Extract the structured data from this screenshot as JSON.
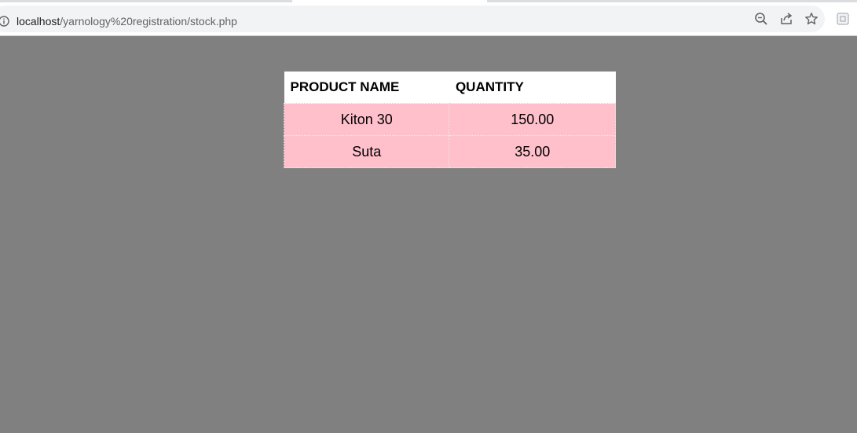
{
  "browser": {
    "url_host": "localhost",
    "url_path": "/yarnology%20registration/stock.php",
    "icons": [
      "info-icon",
      "zoom-icon",
      "share-icon",
      "star-icon",
      "extension-icon"
    ]
  },
  "page": {
    "background": "#808080",
    "row_color": "#ffc0cb"
  },
  "table": {
    "headers": [
      "PRODUCT NAME",
      "QUANTITY"
    ],
    "rows": [
      [
        "Kiton 30",
        "150.00"
      ],
      [
        "Suta",
        "35.00"
      ]
    ]
  }
}
